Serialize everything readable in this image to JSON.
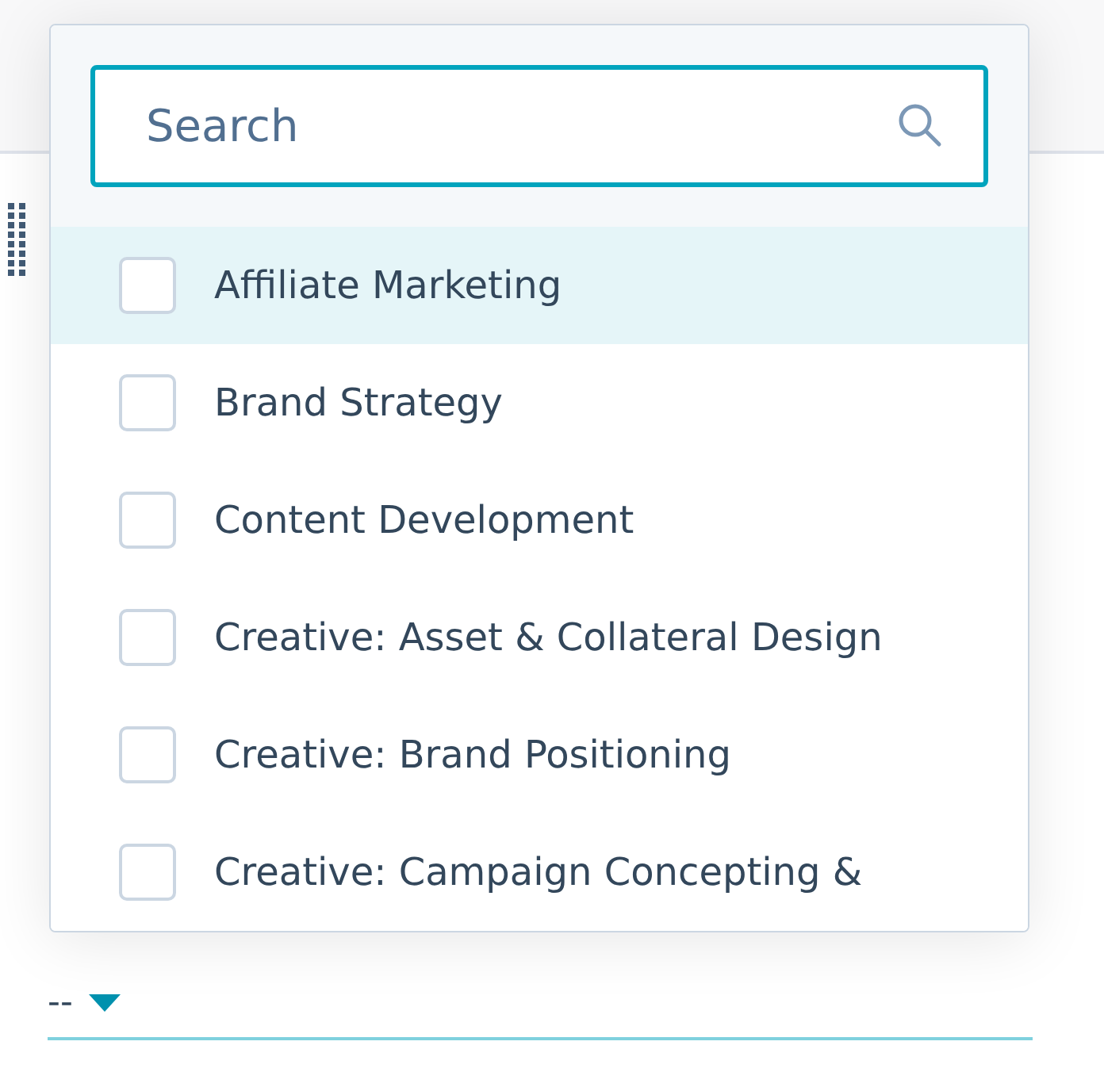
{
  "field": {
    "value": "--"
  },
  "dropdown": {
    "search": {
      "placeholder": "Search"
    },
    "options": [
      {
        "label": "Affiliate Marketing",
        "checked": false,
        "highlighted": true
      },
      {
        "label": "Brand Strategy",
        "checked": false,
        "highlighted": false
      },
      {
        "label": "Content Development",
        "checked": false,
        "highlighted": false
      },
      {
        "label": "Creative: Asset & Collateral Design",
        "checked": false,
        "highlighted": false
      },
      {
        "label": "Creative: Brand Positioning",
        "checked": false,
        "highlighted": false
      },
      {
        "label": "Creative: Campaign Concepting &",
        "checked": false,
        "highlighted": false
      }
    ]
  }
}
